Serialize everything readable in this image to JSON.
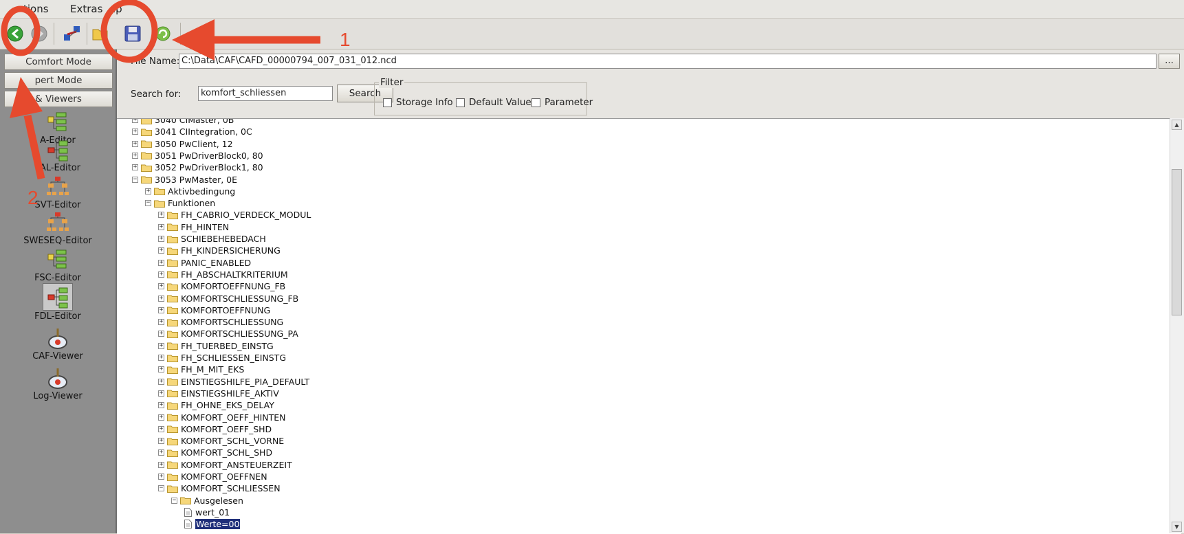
{
  "menu": {
    "items": [
      "tions",
      "Extras",
      "lp"
    ]
  },
  "toolbar": {
    "buttons": [
      "back-icon",
      "forward-icon",
      "connect-icon",
      "open-folder-icon",
      "save-icon",
      "refresh-icon"
    ]
  },
  "sidebar": {
    "modes": [
      "Comfort Mode",
      "pert Mode",
      "& Viewers"
    ],
    "editors": [
      "A-Editor",
      "TAL-Editor",
      "SVT-Editor",
      "SWESEQ-Editor",
      "FSC-Editor",
      "FDL-Editor",
      "CAF-Viewer",
      "Log-Viewer"
    ],
    "selected_editor": "FDL-Editor"
  },
  "main": {
    "file_name_label": "File Name:",
    "file_name_value": "C:\\Data\\CAF\\CAFD_00000794_007_031_012.ncd",
    "browse_label": "...",
    "search_label": "Search for:",
    "search_value": "komfort_schliessen",
    "search_button": "Search",
    "filter_title": "Filter",
    "filters": [
      "Storage Info",
      "Default Values",
      "Parameter"
    ]
  },
  "tree": {
    "nodes": [
      {
        "text": "3040 CIMaster, 0B",
        "level": 0,
        "expanded": false,
        "kind": "folder"
      },
      {
        "text": "3041 CIIntegration, 0C",
        "level": 0,
        "expanded": false,
        "kind": "folder"
      },
      {
        "text": "3050 PwClient, 12",
        "level": 0,
        "expanded": false,
        "kind": "folder"
      },
      {
        "text": "3051 PwDriverBlock0, 80",
        "level": 0,
        "expanded": false,
        "kind": "folder"
      },
      {
        "text": "3052 PwDriverBlock1, 80",
        "level": 0,
        "expanded": false,
        "kind": "folder"
      },
      {
        "text": "3053 PwMaster, 0E",
        "level": 0,
        "expanded": true,
        "kind": "folder"
      },
      {
        "text": "Aktivbedingung",
        "level": 1,
        "expanded": false,
        "kind": "folder"
      },
      {
        "text": "Funktionen",
        "level": 1,
        "expanded": true,
        "kind": "folder"
      },
      {
        "text": "FH_CABRIO_VERDECK_MODUL",
        "level": 2,
        "expanded": false,
        "kind": "folder"
      },
      {
        "text": "FH_HINTEN",
        "level": 2,
        "expanded": false,
        "kind": "folder"
      },
      {
        "text": "SCHIEBEHEBEDACH",
        "level": 2,
        "expanded": false,
        "kind": "folder"
      },
      {
        "text": "FH_KINDERSICHERUNG",
        "level": 2,
        "expanded": false,
        "kind": "folder"
      },
      {
        "text": "PANIC_ENABLED",
        "level": 2,
        "expanded": false,
        "kind": "folder"
      },
      {
        "text": "FH_ABSCHALTKRITERIUM",
        "level": 2,
        "expanded": false,
        "kind": "folder"
      },
      {
        "text": "KOMFORTOEFFNUNG_FB",
        "level": 2,
        "expanded": false,
        "kind": "folder"
      },
      {
        "text": "KOMFORTSCHLIESSUNG_FB",
        "level": 2,
        "expanded": false,
        "kind": "folder"
      },
      {
        "text": "KOMFORTOEFFNUNG",
        "level": 2,
        "expanded": false,
        "kind": "folder"
      },
      {
        "text": "KOMFORTSCHLIESSUNG",
        "level": 2,
        "expanded": false,
        "kind": "folder"
      },
      {
        "text": "KOMFORTSCHLIESSUNG_PA",
        "level": 2,
        "expanded": false,
        "kind": "folder"
      },
      {
        "text": "FH_TUERBED_EINSTG",
        "level": 2,
        "expanded": false,
        "kind": "folder"
      },
      {
        "text": "FH_SCHLIESSEN_EINSTG",
        "level": 2,
        "expanded": false,
        "kind": "folder"
      },
      {
        "text": "FH_M_MIT_EKS",
        "level": 2,
        "expanded": false,
        "kind": "folder"
      },
      {
        "text": "EINSTIEGSHILFE_PIA_DEFAULT",
        "level": 2,
        "expanded": false,
        "kind": "folder"
      },
      {
        "text": "EINSTIEGSHILFE_AKTIV",
        "level": 2,
        "expanded": false,
        "kind": "folder"
      },
      {
        "text": "FH_OHNE_EKS_DELAY",
        "level": 2,
        "expanded": false,
        "kind": "folder"
      },
      {
        "text": "KOMFORT_OEFF_HINTEN",
        "level": 2,
        "expanded": false,
        "kind": "folder"
      },
      {
        "text": "KOMFORT_OEFF_SHD",
        "level": 2,
        "expanded": false,
        "kind": "folder"
      },
      {
        "text": "KOMFORT_SCHL_VORNE",
        "level": 2,
        "expanded": false,
        "kind": "folder"
      },
      {
        "text": "KOMFORT_SCHL_SHD",
        "level": 2,
        "expanded": false,
        "kind": "folder"
      },
      {
        "text": "KOMFORT_ANSTEUERZEIT",
        "level": 2,
        "expanded": false,
        "kind": "folder"
      },
      {
        "text": "KOMFORT_OEFFNEN",
        "level": 2,
        "expanded": false,
        "kind": "folder"
      },
      {
        "text": "KOMFORT_SCHLIESSEN",
        "level": 2,
        "expanded": true,
        "kind": "folder"
      },
      {
        "text": "Ausgelesen",
        "level": 3,
        "expanded": true,
        "kind": "folder"
      },
      {
        "text": "wert_01",
        "level": 4,
        "kind": "doc"
      },
      {
        "text": "Werte=00",
        "level": 4,
        "kind": "doc",
        "selected": true
      }
    ]
  },
  "annotations": {
    "labels": [
      "1",
      "2"
    ],
    "color": "#e64a2e"
  }
}
